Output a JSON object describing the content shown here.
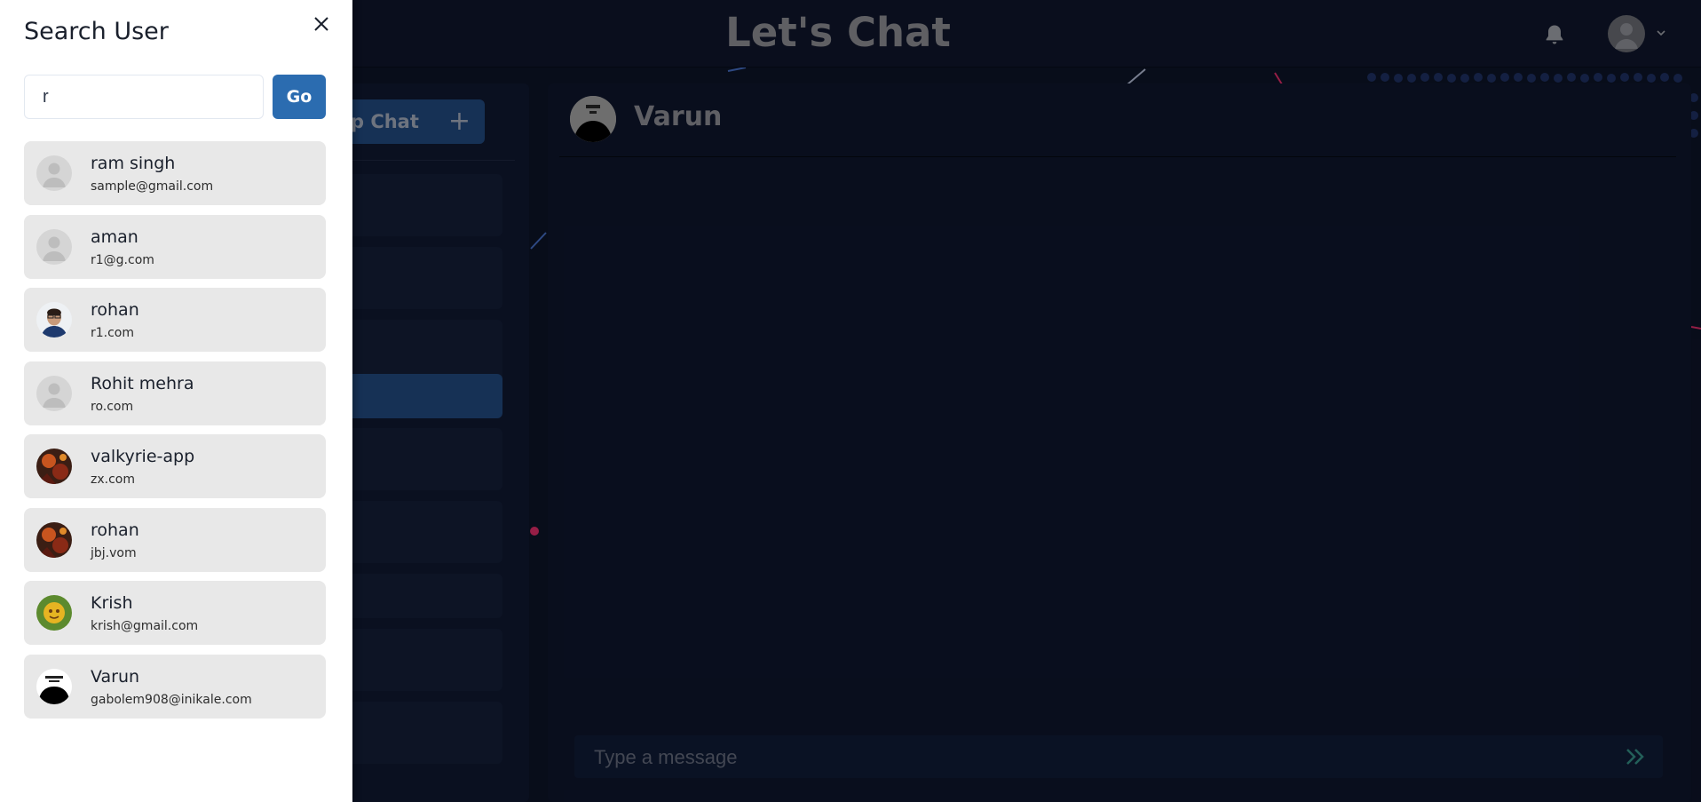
{
  "header": {
    "app_title": "Let's Chat"
  },
  "sidebar": {
    "group_chat_label": "Group Chat",
    "group_chat_icon": "plus-icon"
  },
  "chat": {
    "recipient_name": "Varun",
    "message_placeholder": "Type a message",
    "send_icon": "double-chevron-right-icon"
  },
  "search_drawer": {
    "title": "Search User",
    "query": "r",
    "go_label": "Go",
    "results": [
      {
        "name": "ram singh",
        "email": "sample@gmail.com",
        "avatar": "default"
      },
      {
        "name": "aman",
        "email": "r1@g.com",
        "avatar": "default"
      },
      {
        "name": "rohan",
        "email": "r1.com",
        "avatar": "photo-man"
      },
      {
        "name": "Rohit mehra",
        "email": "ro.com",
        "avatar": "default"
      },
      {
        "name": "valkyrie-app",
        "email": "zx.com",
        "avatar": "photo-dark"
      },
      {
        "name": "rohan",
        "email": "jbj.vom",
        "avatar": "photo-dark"
      },
      {
        "name": "Krish",
        "email": "krish@gmail.com",
        "avatar": "photo-yellow"
      },
      {
        "name": "Varun",
        "email": "gabolem908@inikale.com",
        "avatar": "photo-bw"
      }
    ]
  },
  "colors": {
    "accent": "#2b6cb0",
    "result_bg": "#e8e8e8",
    "app_bg": "#0b1122"
  }
}
